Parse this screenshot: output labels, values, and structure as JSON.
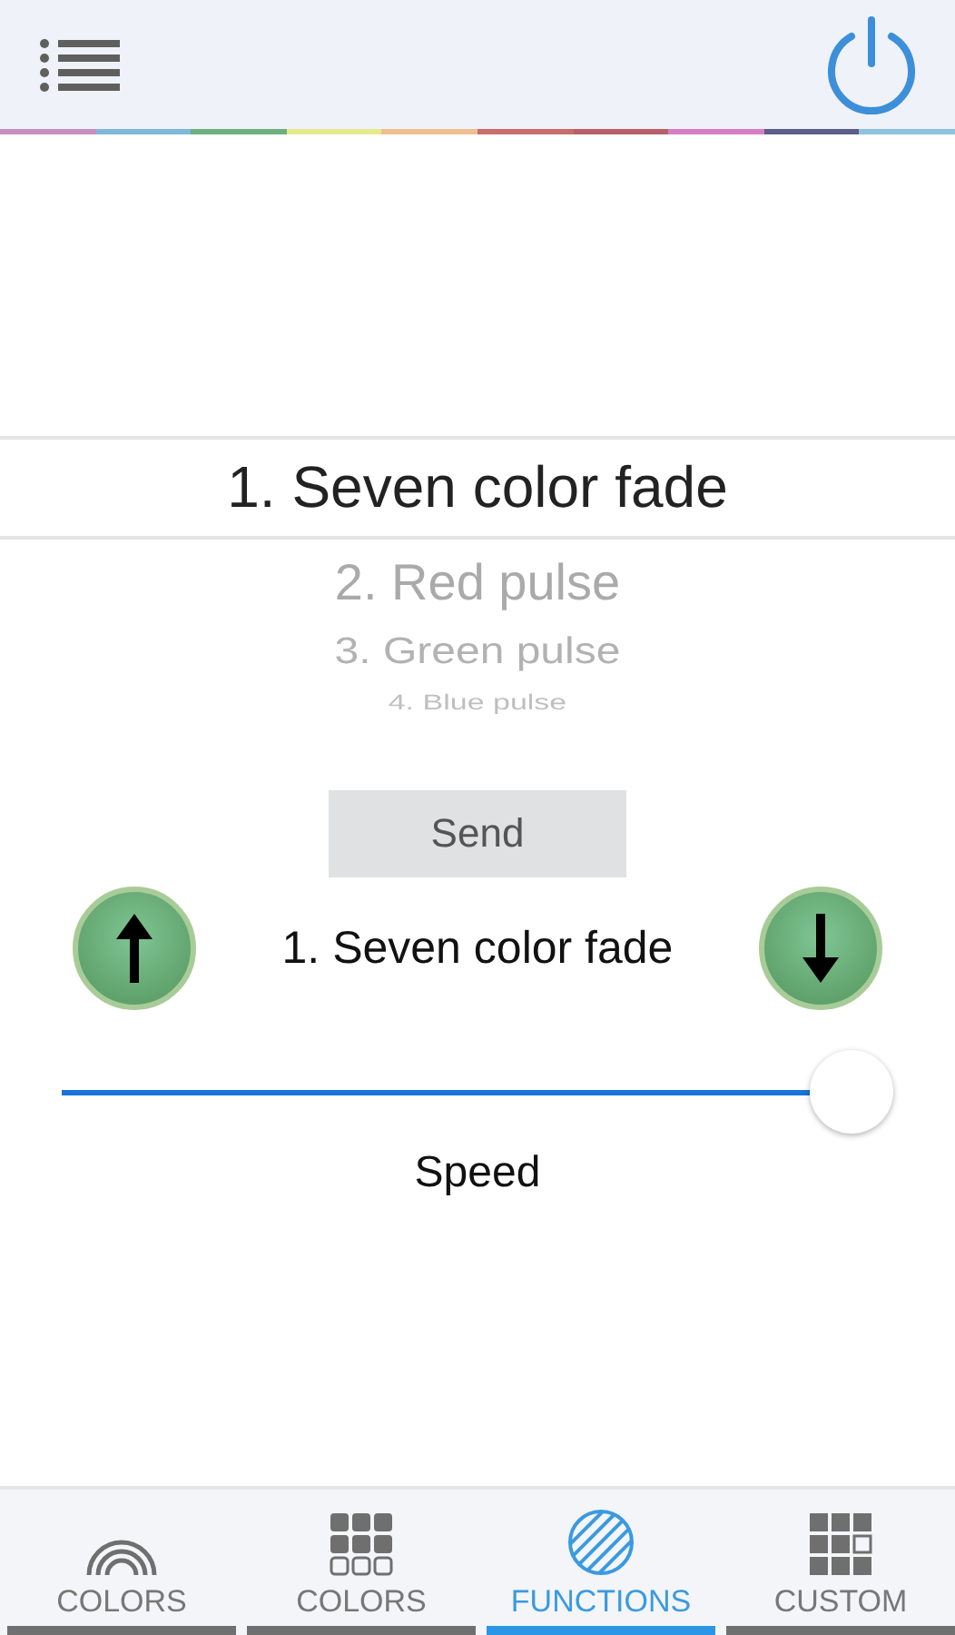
{
  "picker": {
    "items": [
      {
        "label": "1. Seven color fade",
        "selected": true
      },
      {
        "label": "2. Red pulse",
        "selected": false
      },
      {
        "label": "3. Green pulse",
        "selected": false
      },
      {
        "label": "4. Blue pulse",
        "selected": false
      }
    ]
  },
  "send_button": "Send",
  "current_function": "1. Seven color fade",
  "speed": {
    "label": "Speed",
    "level": 1.0
  },
  "tabs": [
    {
      "label": "COLORS",
      "kind": "rainbow",
      "selected": false
    },
    {
      "label": "COLORS",
      "kind": "swatches",
      "selected": false
    },
    {
      "label": "FUNCTIONS",
      "kind": "functions",
      "selected": true
    },
    {
      "label": "CUSTOM",
      "kind": "custom",
      "selected": false
    }
  ]
}
